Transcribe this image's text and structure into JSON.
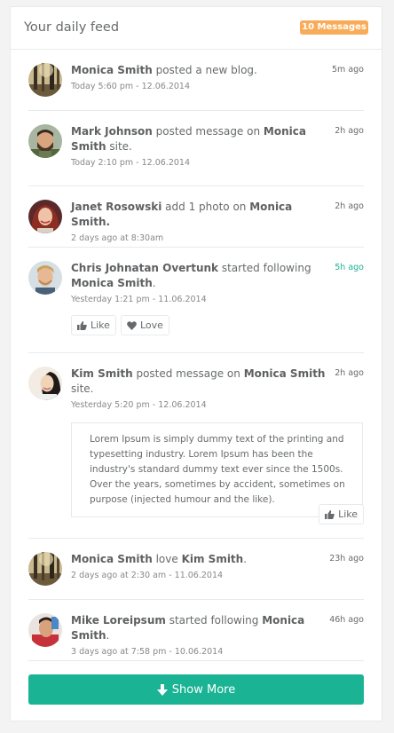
{
  "panel": {
    "title": "Your daily feed",
    "badge": "10 Messages",
    "badge_color": "#f8ac59",
    "accent_color": "#1ab394"
  },
  "feed": [
    {
      "avatar": "forest-photo",
      "actor": "Monica Smith",
      "action": " posted a new blog.",
      "target": "",
      "suffix": "",
      "time": "5m ago",
      "meta": "Today 5:60 pm - 12.06.2014"
    },
    {
      "avatar": "man-bearded",
      "actor": "Mark Johnson",
      "action": " posted message on ",
      "target": "Monica Smith",
      "suffix": " site.",
      "time": "2h ago",
      "meta": "Today 2:10 pm - 12.06.2014"
    },
    {
      "avatar": "woman-redhair",
      "actor": "Janet Rosowski",
      "action": " add 1 photo on ",
      "target": "Monica Smith.",
      "suffix": "",
      "time": "2h ago",
      "meta": "2 days ago at 8:30am"
    },
    {
      "avatar": "man-blond",
      "actor": "Chris Johnatan Overtunk",
      "action": " started following ",
      "target": "Monica Smith",
      "suffix": ".",
      "time": "5h ago",
      "meta": "Yesterday 1:21 pm - 11.06.2014",
      "like_label": "Like",
      "love_label": "Love"
    },
    {
      "avatar": "woman-asian",
      "actor": "Kim Smith",
      "action": " posted message on ",
      "target": "Monica Smith",
      "suffix": " site.",
      "time": "2h ago",
      "meta": "Yesterday 5:20 pm - 12.06.2014",
      "quote": "Lorem Ipsum is simply dummy text of the printing and typesetting industry. Lorem Ipsum has been the industry's standard dummy text ever since the 1500s. Over the years, sometimes by accident, sometimes on purpose (injected humour and the like).",
      "like_label": "Like"
    },
    {
      "avatar": "forest-photo",
      "actor": "Monica Smith",
      "action": " love ",
      "target": "Kim Smith",
      "suffix": ".",
      "time": "23h ago",
      "meta": "2 days ago at 2:30 am - 11.06.2014"
    },
    {
      "avatar": "man-redshirt",
      "actor": "Mike Loreipsum",
      "action": " started following ",
      "target": "Monica Smith",
      "suffix": ".",
      "time": "46h ago",
      "meta": "3 days ago at 7:58 pm - 10.06.2014"
    }
  ],
  "show_more_label": "Show More"
}
